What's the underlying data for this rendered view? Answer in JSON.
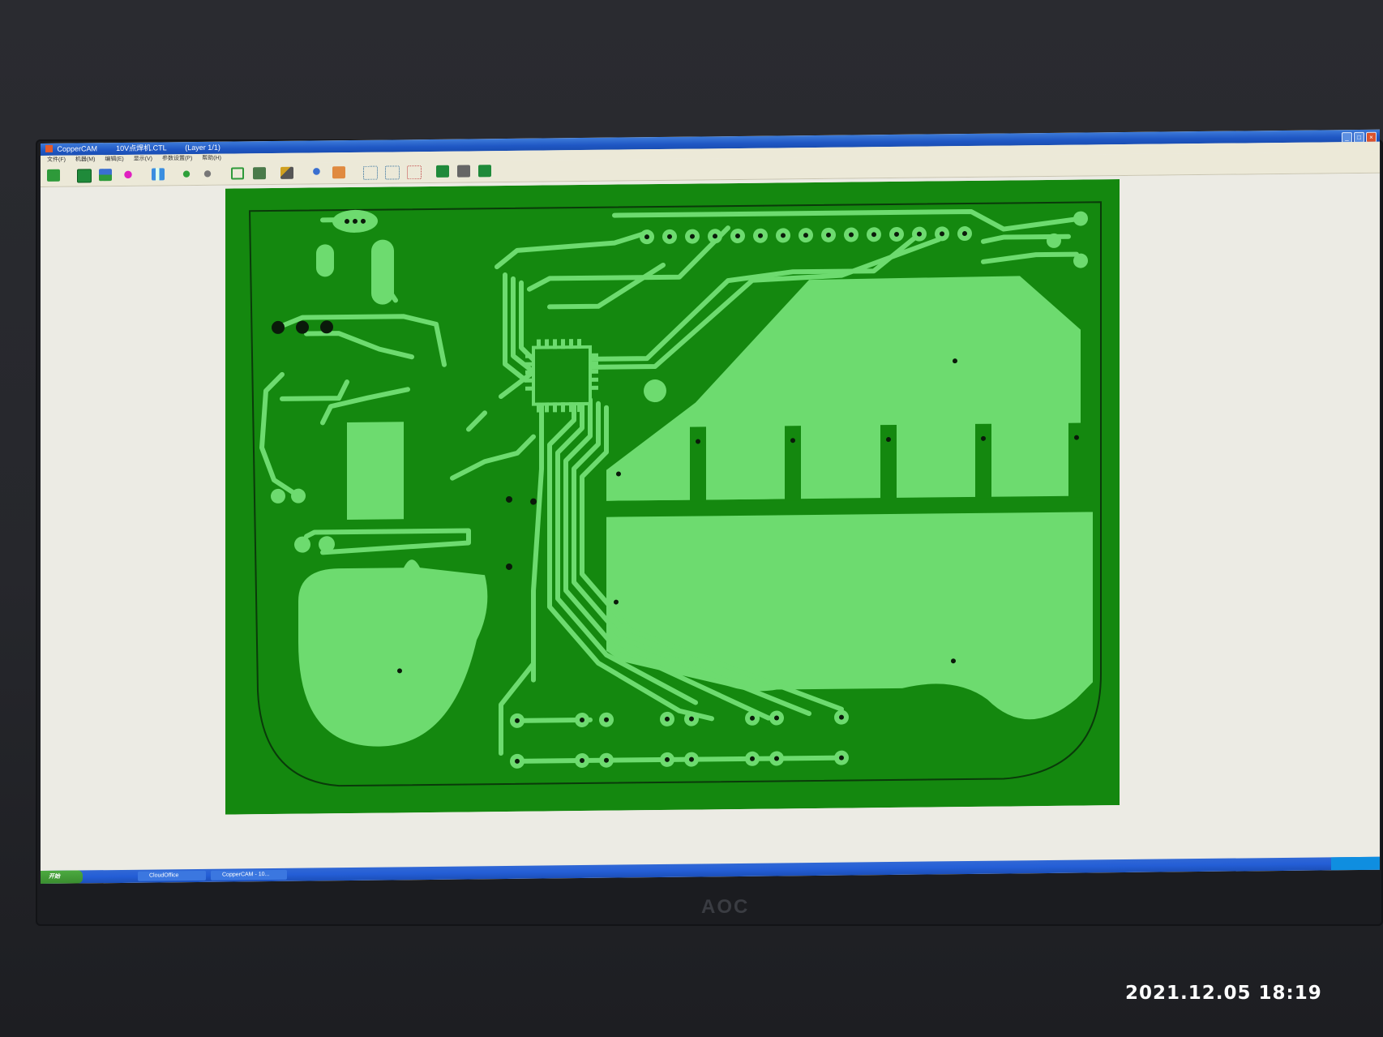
{
  "window": {
    "app_name": "CopperCAM",
    "file_name": "10V点焊机.CTL",
    "layer": "(Layer 1/1)"
  },
  "menu": [
    "文件(F)",
    "机器(M)",
    "编辑(E)",
    "显示(V)",
    "参数设置(P)",
    "帮助(H)"
  ],
  "toolbar_icons": [
    "open-icon",
    "board-icon",
    "layer-icon",
    "drill-icon",
    "pad-icon",
    "track-icon",
    "tool-icon",
    "frame-icon",
    "mill-icon",
    "contour-icon",
    "zoom-icon",
    "settings-icon",
    "grid-icon",
    "grid-alt-icon",
    "dots-icon",
    "layer1-icon",
    "layer2-icon",
    "layer3-icon"
  ],
  "taskbar": {
    "start_label": "开始",
    "task1": "CloudOffice",
    "task2": "CopperCAM - 10..."
  },
  "monitor_brand": "AOC",
  "photo_timestamp": "2021.12.05 18:19",
  "colors": {
    "board_dark": "#14880f",
    "copper_light": "#6ddb6f",
    "desktop_bg": "#ecebe4",
    "titlebar": "#1f57c4"
  }
}
